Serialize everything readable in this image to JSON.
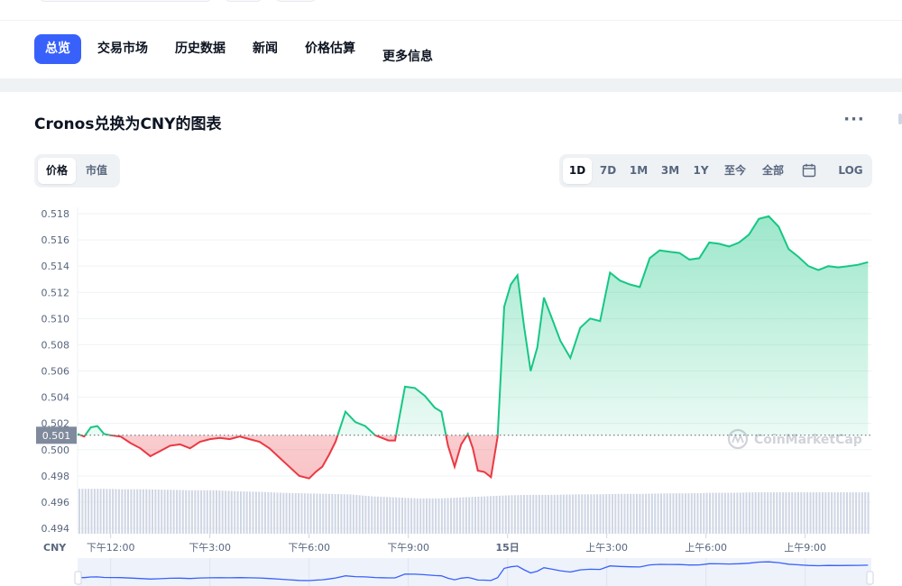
{
  "nav": {
    "tabs": [
      {
        "label": "总览",
        "active": true
      },
      {
        "label": "交易市场"
      },
      {
        "label": "历史数据"
      },
      {
        "label": "新闻"
      },
      {
        "label": "价格估算"
      },
      {
        "label": "更多信息"
      }
    ]
  },
  "card": {
    "title": "Cronos兑换为CNY的图表",
    "more_icon": "ellipsis-icon"
  },
  "metric_toggle": {
    "options": [
      "价格",
      "市值"
    ],
    "selected": "价格"
  },
  "range_toggle": {
    "options": [
      "1D",
      "7D",
      "1M",
      "3M",
      "1Y",
      "至今",
      "全部"
    ],
    "selected": "1D",
    "calendar_icon": "calendar-icon",
    "log_label": "LOG"
  },
  "watermark": "CoinMarketCap",
  "colors": {
    "accent": "#3861fb",
    "up": "#16c784",
    "down": "#ea3943"
  },
  "chart_data": {
    "type": "line",
    "currency_label": "CNY",
    "current_price_label": "0.501",
    "baseline": 0.5011,
    "ylim": [
      0.494,
      0.519
    ],
    "yticks": [
      "0.518",
      "0.516",
      "0.514",
      "0.512",
      "0.510",
      "0.508",
      "0.506",
      "0.504",
      "0.502",
      "0.500",
      "0.498",
      "0.496",
      "0.494"
    ],
    "xtick_labels": [
      "下午12:00",
      "下午3:00",
      "下午6:00",
      "下午9:00",
      "15日",
      "上午3:00",
      "上午6:00",
      "上午9:00"
    ],
    "xtick_hours": [
      12,
      15,
      18,
      21,
      24,
      27,
      30,
      33
    ],
    "xlim_hours": [
      11.0,
      35.0
    ],
    "series": [
      {
        "x_hours": [
          11.0,
          11.2,
          11.4,
          11.6,
          11.8,
          12.0,
          12.3,
          12.6,
          12.9,
          13.2,
          13.5,
          13.8,
          14.1,
          14.4,
          14.7,
          15.0,
          15.3,
          15.6,
          15.9,
          16.2,
          16.5,
          16.8,
          17.1,
          17.4,
          17.7,
          18.0,
          18.2,
          18.4,
          18.6,
          18.8,
          19.1,
          19.4,
          19.7,
          20.0,
          20.2,
          20.4,
          20.6,
          20.9,
          21.2,
          21.5,
          21.8,
          22.0,
          22.2,
          22.4,
          22.6,
          22.8,
          22.95,
          23.1,
          23.3,
          23.5,
          23.7,
          23.9,
          24.1,
          24.3,
          24.5,
          24.7,
          24.9,
          25.1,
          25.3,
          25.6,
          25.9,
          26.2,
          26.5,
          26.8,
          27.1,
          27.4,
          27.7,
          28.0,
          28.3,
          28.6,
          28.9,
          29.2,
          29.5,
          29.8,
          30.1,
          30.4,
          30.7,
          31.0,
          31.3,
          31.6,
          31.9,
          32.2,
          32.5,
          32.8,
          33.1,
          33.4,
          33.7,
          34.0,
          34.3,
          34.6,
          34.9
        ],
        "values": [
          0.5012,
          0.501,
          0.5017,
          0.5018,
          0.5012,
          0.5011,
          0.501,
          0.5005,
          0.5001,
          0.4995,
          0.4999,
          0.5003,
          0.5004,
          0.5001,
          0.5006,
          0.5008,
          0.5009,
          0.5008,
          0.501,
          0.5008,
          0.5006,
          0.5001,
          0.4994,
          0.4987,
          0.498,
          0.4978,
          0.4983,
          0.4987,
          0.4996,
          0.5006,
          0.5029,
          0.5021,
          0.5018,
          0.5011,
          0.5009,
          0.5007,
          0.5007,
          0.5048,
          0.5047,
          0.5041,
          0.5032,
          0.5029,
          0.5003,
          0.4987,
          0.5004,
          0.5012,
          0.5001,
          0.4984,
          0.4983,
          0.4979,
          0.501,
          0.5109,
          0.5126,
          0.5133,
          0.5094,
          0.506,
          0.5078,
          0.5116,
          0.5103,
          0.5083,
          0.507,
          0.5093,
          0.51,
          0.5098,
          0.5135,
          0.5129,
          0.5126,
          0.5124,
          0.5146,
          0.5152,
          0.5151,
          0.515,
          0.5145,
          0.5146,
          0.5158,
          0.5157,
          0.5155,
          0.5158,
          0.5164,
          0.5176,
          0.5178,
          0.517,
          0.5153,
          0.5147,
          0.514,
          0.5137,
          0.514,
          0.5139,
          0.514,
          0.5141,
          0.5143
        ]
      }
    ],
    "volume_fraction": [
      0.89,
      0.89,
      0.88,
      0.88,
      0.87,
      0.86,
      0.86,
      0.84,
      0.83,
      0.81,
      0.8,
      0.79,
      0.78,
      0.74,
      0.72,
      0.7,
      0.7,
      0.72,
      0.74,
      0.76,
      0.77,
      0.77,
      0.78,
      0.78,
      0.79,
      0.79,
      0.8,
      0.8,
      0.81,
      0.81,
      0.82,
      0.82,
      0.82,
      0.82,
      0.82,
      0.82
    ]
  }
}
